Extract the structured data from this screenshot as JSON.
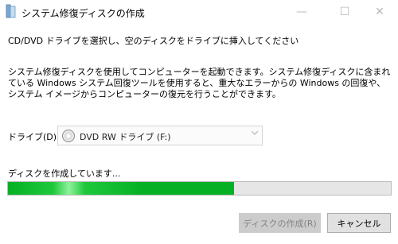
{
  "window": {
    "title": "システム修復ディスクの作成",
    "controls": {
      "minimize": "—",
      "maximize": "☐",
      "close": "✕"
    }
  },
  "instruction": "CD/DVD ドライブを選択し、空のディスクをドライブに挿入してください",
  "description": "システム修復ディスクを使用してコンピューターを起動できます。システム修復ディスクに含まれている Windows システム回復ツールを使用すると、重大なエラーからの Windows の回復や、システム イメージからコンピューターの復元を行うことができます。",
  "drive": {
    "label": "ドライブ(D):",
    "selected": "DVD RW ドライブ (F:)",
    "icon": "disc-icon"
  },
  "progress": {
    "status": "ディスクを作成しています...",
    "fraction": 0.59,
    "color": "#06b025"
  },
  "buttons": {
    "create": "ディスクの作成(R)",
    "cancel": "キャンセル"
  }
}
